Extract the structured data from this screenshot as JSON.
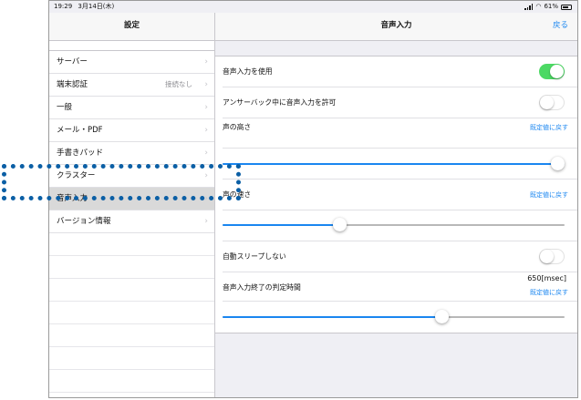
{
  "status": {
    "time": "19:29",
    "date": "3月14日(木)",
    "battery": "61%"
  },
  "sidebar": {
    "title": "設定",
    "items": [
      {
        "label": "サーバー",
        "detail": ""
      },
      {
        "label": "端末認証",
        "detail": "接続なし"
      },
      {
        "label": "一般",
        "detail": ""
      },
      {
        "label": "メール・PDF",
        "detail": ""
      },
      {
        "label": "手書きパッド",
        "detail": ""
      },
      {
        "label": "クラスター",
        "detail": ""
      },
      {
        "label": "音声入力",
        "detail": ""
      },
      {
        "label": "バージョン情報",
        "detail": ""
      }
    ],
    "selected_index": 6
  },
  "main": {
    "title": "音声入力",
    "back_label": "戻る",
    "reset_label": "既定値に戻す",
    "rows": {
      "use_voice": {
        "label": "音声入力を使用",
        "on": true
      },
      "voiceover": {
        "label": "アンサーバック中に音声入力を許可",
        "on": false
      },
      "pitch": {
        "label": "声の高さ",
        "value": 1.0
      },
      "speed": {
        "label": "声の速さ",
        "value": 0.34
      },
      "auto_sleep": {
        "label": "自動スリープしない",
        "on": false
      },
      "end_time": {
        "label": "音声入力終了の判定時間",
        "value_text": "650[msec]",
        "value": 0.64
      }
    }
  },
  "colors": {
    "accent": "#1a86f0",
    "toggle_on": "#4cd964",
    "highlight": "#0b5fa5"
  }
}
